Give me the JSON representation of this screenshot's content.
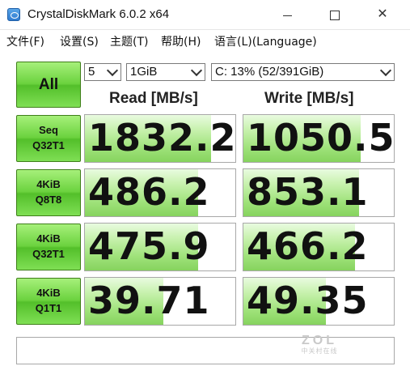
{
  "window": {
    "title": "CrystalDiskMark 6.0.2 x64"
  },
  "menu": {
    "items": [
      "文件(F)",
      "设置(S)",
      "主题(T)",
      "帮助(H)",
      "语言(L)(Language)"
    ]
  },
  "controls": {
    "all_label": "All",
    "count": "5",
    "size": "1GiB",
    "drive": "C: 13% (52/391GiB)"
  },
  "columns": {
    "read": "Read [MB/s]",
    "write": "Write [MB/s]"
  },
  "tests": [
    {
      "line1": "Seq",
      "line2": "Q32T1",
      "read": "1832.2",
      "write": "1050.5",
      "read_fill": 0.84,
      "write_fill": 0.78
    },
    {
      "line1": "4KiB",
      "line2": "Q8T8",
      "read": "486.2",
      "write": "853.1",
      "read_fill": 0.75,
      "write_fill": 0.77
    },
    {
      "line1": "4KiB",
      "line2": "Q32T1",
      "read": "475.9",
      "write": "466.2",
      "read_fill": 0.75,
      "write_fill": 0.74
    },
    {
      "line1": "4KiB",
      "line2": "Q1T1",
      "read": "39.71",
      "write": "49.35",
      "read_fill": 0.52,
      "write_fill": 0.55
    }
  ],
  "comment": "",
  "watermark": {
    "big": "ZOL",
    "small": "中关村在线"
  }
}
